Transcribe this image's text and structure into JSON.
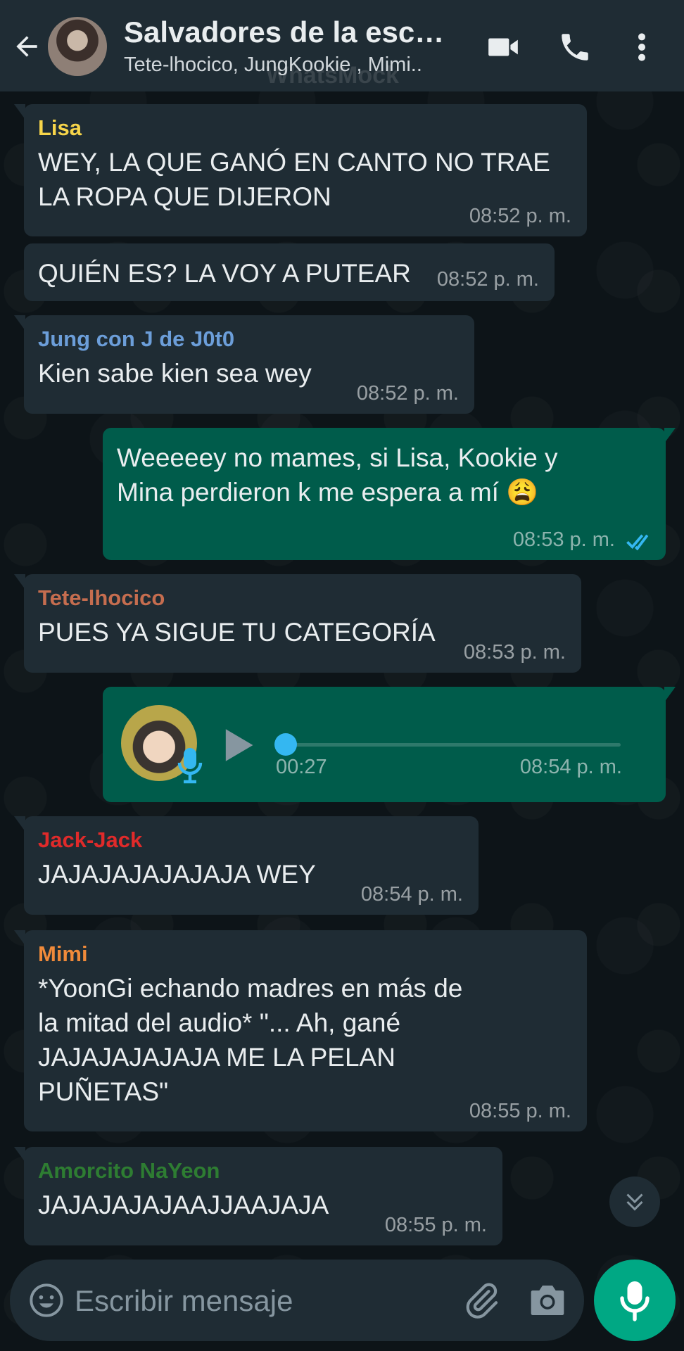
{
  "app_watermark": "WhatsMock",
  "header": {
    "title": "Salvadores de la escu…",
    "subtitle": "Tete-lhocico, JungKookie , Mimi.."
  },
  "colors": {
    "header_bg": "#1f2c34",
    "incoming_bubble": "#1f2c34",
    "outgoing_bubble": "#005c4b",
    "accent": "#00a884",
    "read_ticks": "#34b7f1"
  },
  "messages": [
    {
      "sender": "Lisa",
      "sender_color": "#f7d54a",
      "text": "WEY, LA QUE GANÓ EN CANTO NO TRAE LA ROPA QUE DIJERON",
      "time": "08:52 p. m."
    },
    {
      "sender": "",
      "text": "QUIÉN ES? LA VOY A PUTEAR",
      "time": "08:52 p. m."
    },
    {
      "sender": "Jung con J de J0t0",
      "sender_color": "#6c9ed9",
      "text": "Kien sabe kien sea wey",
      "time": "08:52 p. m."
    },
    {
      "outgoing": true,
      "text": "Weeeeey no mames, si Lisa, Kookie y Mina perdieron k me espera a mí 😩",
      "time": "08:53 p. m.",
      "status": "read"
    },
    {
      "sender": "Tete-lhocico",
      "sender_color": "#c56d4f",
      "text": "PUES YA SIGUE TU CATEGORÍA",
      "time": "08:53 p. m."
    },
    {
      "outgoing": true,
      "type": "voice",
      "duration": "00:27",
      "progress": 0,
      "time": "08:54 p. m."
    },
    {
      "sender": "Jack-Jack",
      "sender_color": "#e02a2a",
      "text": "JAJAJAJAJAJAJA WEY",
      "time": "08:54 p. m."
    },
    {
      "sender": "Mimi",
      "sender_color": "#f08a3a",
      "text": "*YoonGi echando madres en más de la mitad del audio* \"... Ah, gané JAJAJAJAJAJA ME LA PELAN PUÑETAS\"",
      "time": "08:55 p. m."
    },
    {
      "sender": "Amorcito NaYeon",
      "sender_color": "#2e7d32",
      "text": "JAJAJAJAJAAJJAAJAJA",
      "time": "08:55 p. m."
    }
  ],
  "composer": {
    "placeholder": "Escribir mensaje"
  }
}
